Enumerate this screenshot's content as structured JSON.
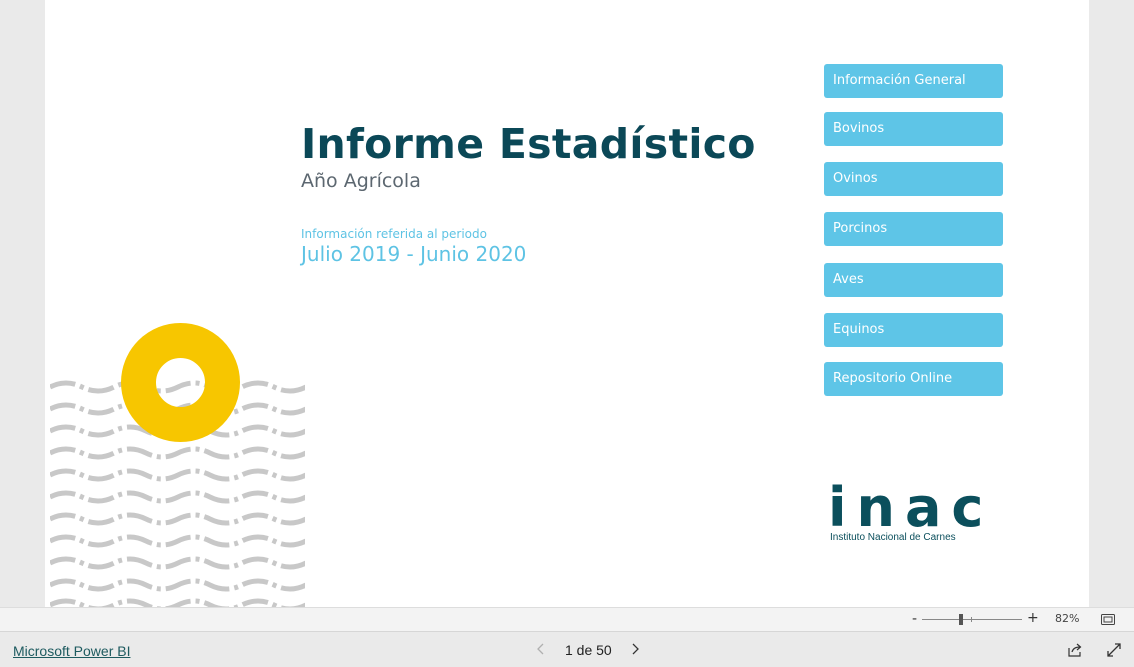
{
  "report": {
    "title": "Informe Estadístico",
    "subtitle": "Año Agrícola",
    "period_label": "Información referida al periodo",
    "period_value": "Julio 2019 - Junio 2020"
  },
  "nav_buttons": [
    {
      "label": "Información General"
    },
    {
      "label": "Bovinos"
    },
    {
      "label": "Ovinos"
    },
    {
      "label": "Porcinos"
    },
    {
      "label": "Aves"
    },
    {
      "label": "Equinos"
    },
    {
      "label": "Repositorio Online"
    }
  ],
  "logo": {
    "text": "inac",
    "subtitle": "Instituto Nacional de Carnes"
  },
  "zoom": {
    "minus": "-",
    "plus": "+",
    "value": "82%"
  },
  "footer": {
    "brand": "Microsoft Power BI",
    "page_indicator": "1 de 50"
  },
  "colors": {
    "title": "#0b4857",
    "accent": "#5ec5e7",
    "sun": "#f7c600",
    "waves": "#c8c8c8"
  },
  "icons": {
    "prev": "chevron-left-icon",
    "next": "chevron-right-icon",
    "share": "share-icon",
    "expand": "expand-icon",
    "fit": "fit-to-page-icon"
  }
}
